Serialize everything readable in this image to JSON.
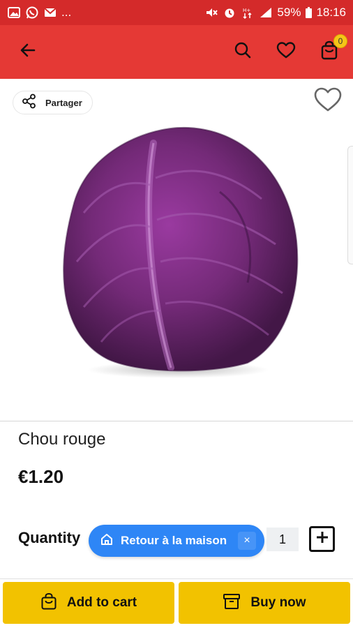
{
  "status_bar": {
    "dots": "...",
    "battery": "59%",
    "time": "18:16",
    "icons": [
      "image-icon",
      "whatsapp-icon",
      "mail-icon",
      "mute-icon",
      "alarm-icon",
      "network-icon",
      "signal-icon",
      "battery-icon"
    ]
  },
  "app_bar": {
    "background": "#e53935",
    "cart_count": "0",
    "icons": [
      "back-arrow-icon",
      "search-icon",
      "heart-icon",
      "cart-icon"
    ]
  },
  "image_area": {
    "share_label": "Partager",
    "icons": [
      "share-icon",
      "favorite-heart-icon"
    ]
  },
  "product": {
    "name": "Chou rouge",
    "price": "€1.20"
  },
  "quantity": {
    "label": "Quantity",
    "value": "1"
  },
  "toast": {
    "label": "Retour à la maison",
    "close": "×",
    "color": "#2e86f6"
  },
  "bottom_bar": {
    "add_to_cart": "Add to cart",
    "buy_now": "Buy now",
    "button_color": "#f2c200"
  }
}
